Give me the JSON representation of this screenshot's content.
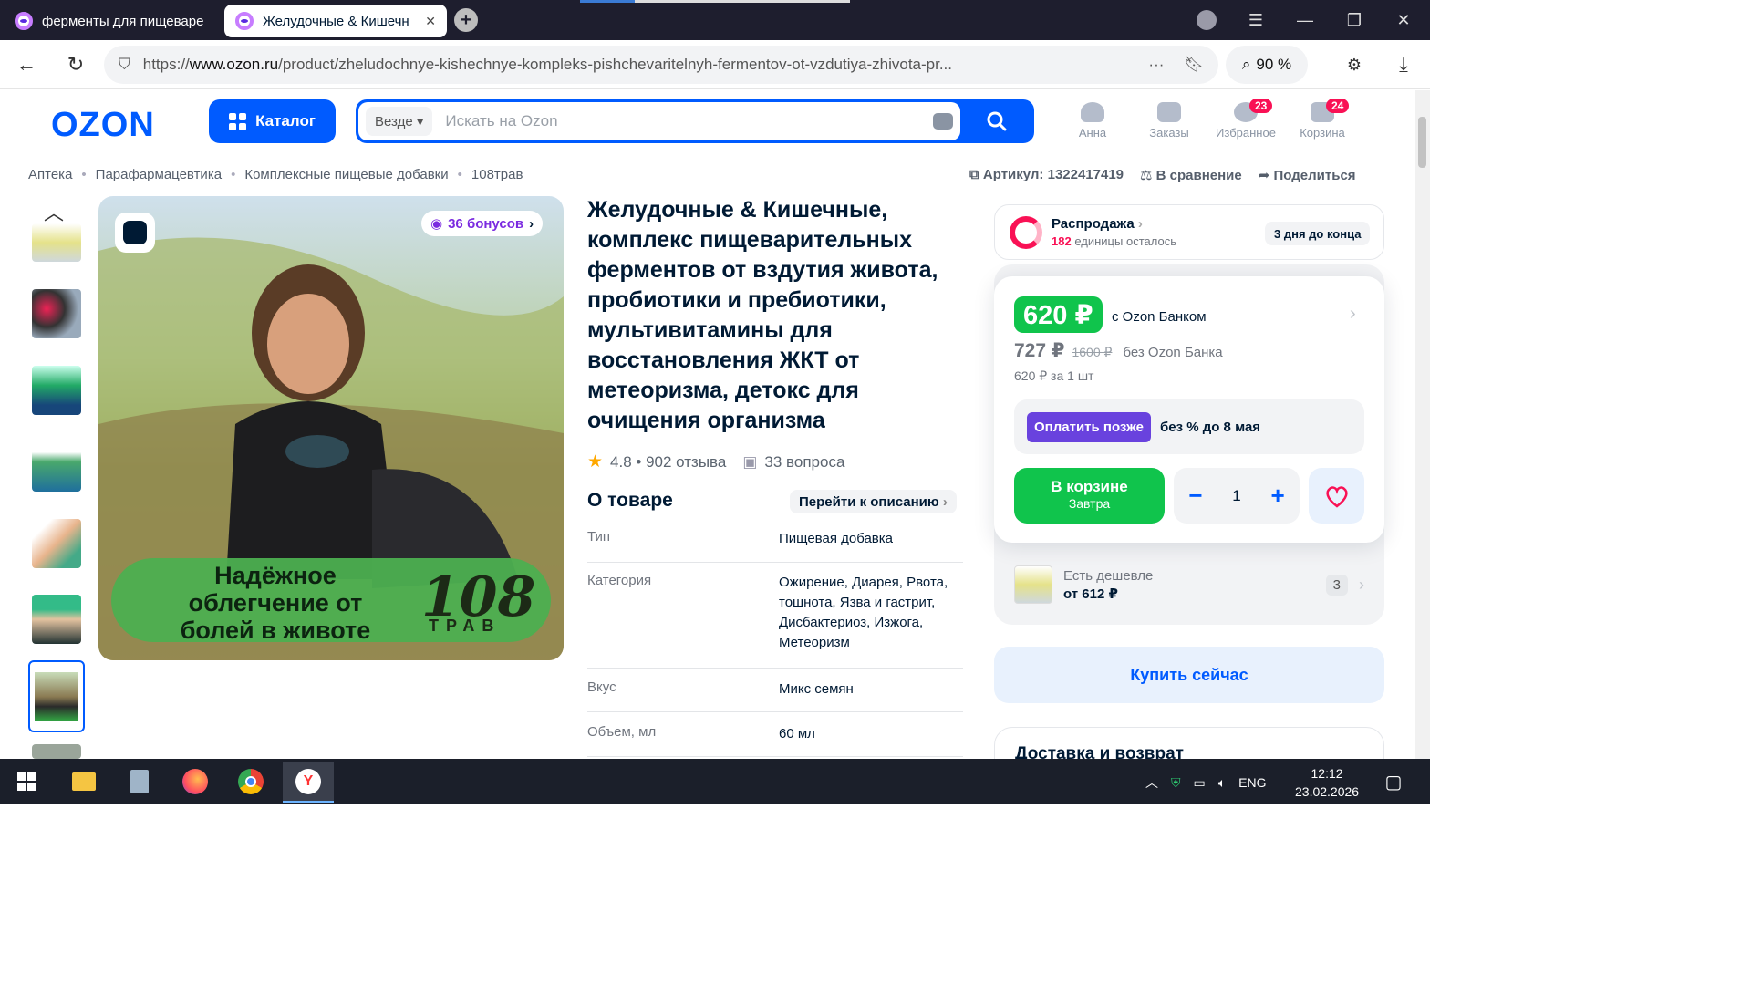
{
  "browser": {
    "tabs": [
      {
        "title": "ферменты для пищеваре"
      },
      {
        "title": "Желудочные & Кишечн"
      }
    ],
    "url_prefix": "https://",
    "url_host": "www.ozon.ru",
    "url_path": "/product/zheludochnye-kishechnye-kompleks-pishchevaritelnyh-fermentov-ot-vzdutiya-zhivota-pr...",
    "zoom": "90 %"
  },
  "header": {
    "logo": "OZON",
    "catalog_label": "Каталог",
    "search_scope": "Везде",
    "search_placeholder": "Искать на Ozon",
    "user_label": "Анна",
    "orders_label": "Заказы",
    "favorites_label": "Избранное",
    "favorites_count": "23",
    "cart_label": "Корзина",
    "cart_count": "24"
  },
  "breadcrumbs": [
    "Аптека",
    "Парафармацевтика",
    "Комплексные пищевые добавки",
    "108трав"
  ],
  "article": {
    "sku_label": "Артикул: 1322417419",
    "compare_label": "В сравнение",
    "share_label": "Поделиться"
  },
  "gallery": {
    "bonus": "36 бонусов",
    "banner_text": "Надёжное облегчение от болей в животе",
    "brand_number": "108",
    "brand_word": "ТРАВ"
  },
  "product": {
    "title": "Желудочные & Кишечные, комплекс пищеварительных ферментов от вздутия живота, пробиотики и пребиотики, мультивитамины для восстановления ЖКТ от метеоризма, детокс для очищения организма",
    "rating": "4.8",
    "reviews": "902 отзыва",
    "questions": "33 вопроса",
    "about_heading": "О товаре",
    "go_description": "Перейти к описанию",
    "props": [
      {
        "key": "Тип",
        "value": "Пищевая добавка"
      },
      {
        "key": "Категория",
        "value": "Ожирение, Диарея, Рвота, тошнота, Язва и гастрит, Дисбактериоз, Изжога, Метеоризм"
      },
      {
        "key": "Вкус",
        "value": "Микс семян"
      },
      {
        "key": "Объем, мл",
        "value": "60 мл"
      }
    ]
  },
  "sale": {
    "title": "Распродажа",
    "remaining_count": "182",
    "remaining_text": "единицы осталось",
    "ends": "3 дня до конца"
  },
  "price": {
    "bank_price": "620 ₽",
    "bank_label": "с Ozon Банком",
    "regular_price": "727 ₽",
    "old_price": "1600 ₽",
    "regular_label": "без Ozon Банка",
    "unit_price": "620 ₽ за 1 шт",
    "pay_later_button": "Оплатить позже",
    "pay_later_text": "без % до 8 мая",
    "in_cart_label": "В корзине",
    "in_cart_sub": "Завтра",
    "quantity": "1",
    "cheaper_label": "Есть дешевле",
    "cheaper_price": "от 612 ₽",
    "cheaper_count": "3",
    "buy_now": "Купить сейчас",
    "delivery_heading": "Доставка и возврат"
  },
  "taskbar": {
    "language": "ENG",
    "time": "12:12",
    "date": "23.02.2026"
  },
  "colors": {
    "ozon_blue": "#005bff",
    "price_green": "#10c44c",
    "badge_pink": "#f91155",
    "paylater_purple": "#6942de"
  }
}
